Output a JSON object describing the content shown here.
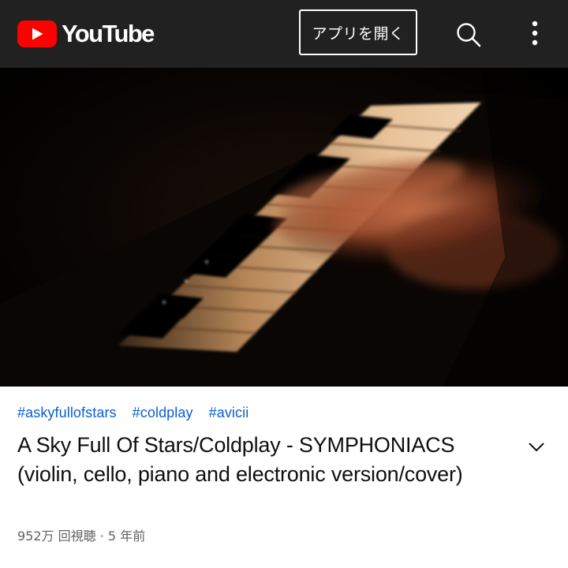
{
  "header": {
    "logo_text": "YouTube",
    "open_app_label": "アプリを開く",
    "icons": {
      "logo": "youtube-play-logo-icon",
      "search": "search-icon",
      "more": "more-vertical-icon"
    },
    "colors": {
      "bar_background": "#212121",
      "logo_red": "#ff0000"
    }
  },
  "video": {
    "hashtags": [
      "#askyfullofstars",
      "#coldplay",
      "#avicii"
    ],
    "title": "A Sky Full Of Stars/Coldplay - SYMPHONIACS (violin, cello, piano and electronic version/cover)",
    "views": "952万 回視聴",
    "separator": "·",
    "age": "5 年前",
    "expand_icon": "chevron-down-icon",
    "colors": {
      "hashtag": "#065fd4",
      "title": "#0f0f0f",
      "stats": "#606060"
    }
  }
}
